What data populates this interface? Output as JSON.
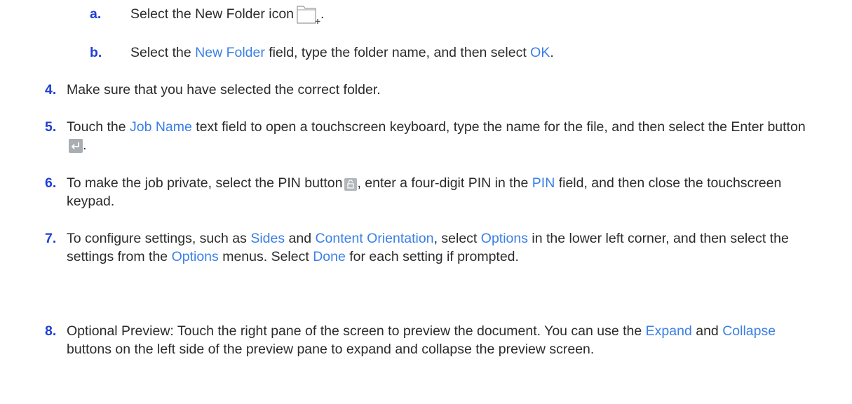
{
  "steps": {
    "a": {
      "num": "a.",
      "before": "Select the New Folder icon",
      "after": "."
    },
    "b": {
      "num": "b.",
      "p1": "Select the ",
      "l1": "New Folder",
      "p2": " field, type the folder name, and then select ",
      "l2": "OK",
      "p3": "."
    },
    "s4": {
      "num": "4.",
      "text": "Make sure that you have selected the correct folder."
    },
    "s5": {
      "num": "5.",
      "p1": "Touch the ",
      "l1": "Job Name",
      "p2": " text field to open a touchscreen keyboard, type the name for the file, and then select the Enter button",
      "p3": "."
    },
    "s6": {
      "num": "6.",
      "p1": "To make the job private, select the PIN button",
      "p2": ", enter a four-digit PIN in the ",
      "l1": "PIN",
      "p3": " field, and then close the touchscreen keypad."
    },
    "s7": {
      "num": "7.",
      "p1": "To configure settings, such as ",
      "l1": "Sides",
      "p2": " and ",
      "l2": "Content Orientation",
      "p3": ", select ",
      "l3": "Options",
      "p4": " in the lower left corner, and then select the settings from the ",
      "l4": "Options",
      "p5": " menus. Select ",
      "l5": "Done",
      "p6": " for each setting if prompted."
    },
    "s8": {
      "num": "8.",
      "p1": "Optional Preview: Touch the right pane of the screen to preview the document. You can use the ",
      "l1": "Expand",
      "p2": " and ",
      "l2": "Collapse",
      "p3": " buttons on the left side of the preview pane to expand and collapse the preview screen."
    }
  },
  "icons": {
    "new_folder": "new-folder-icon",
    "enter": "enter-icon",
    "pin": "pin-icon"
  },
  "colors": {
    "number": "#1f3fd4",
    "link": "#3a7fe6",
    "body_text": "#2b2b2b"
  }
}
